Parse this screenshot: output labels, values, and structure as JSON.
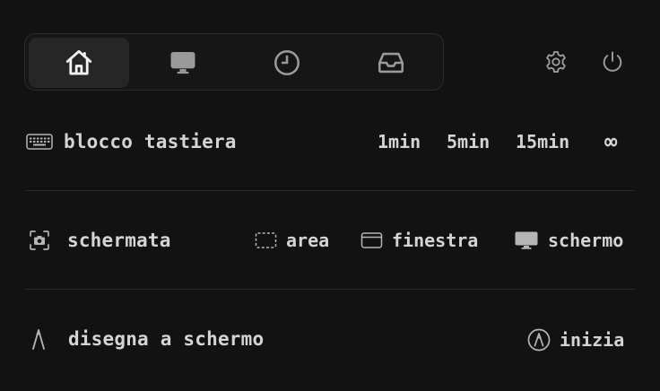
{
  "tabs": [
    {
      "icon": "home-icon",
      "active": true
    },
    {
      "icon": "monitor-icon",
      "active": false
    },
    {
      "icon": "clock-icon",
      "active": false
    },
    {
      "icon": "inbox-icon",
      "active": false
    }
  ],
  "header_icons": [
    "gear-icon",
    "power-icon"
  ],
  "keyboard_lock": {
    "label": "blocco tastiera",
    "options": [
      "1min",
      "5min",
      "15min",
      "∞"
    ]
  },
  "screenshot": {
    "label": "schermata",
    "options": {
      "area": "area",
      "window": "finestra",
      "screen": "schermo"
    }
  },
  "draw": {
    "label": "disegna a schermo",
    "start": "inizia"
  },
  "colors": {
    "background": "#121212",
    "text": "#d6d6d6",
    "active_tab": "#262626"
  }
}
